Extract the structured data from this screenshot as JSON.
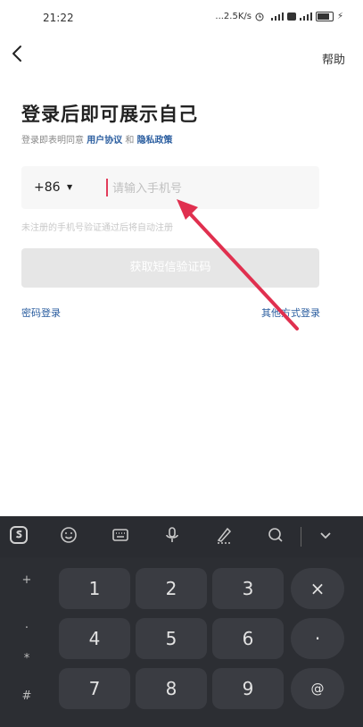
{
  "status_bar": {
    "time": "21:22",
    "net_speed": "...2.5K/s"
  },
  "header": {
    "help_label": "帮助"
  },
  "login": {
    "title": "登录后即可展示自己",
    "agreement_prefix": "登录即表明同意",
    "user_agreement": "用户协议",
    "and_text": "和",
    "privacy_policy": "隐私政策",
    "country_code": "+86",
    "country_dropdown_icon": "triangle-down-icon",
    "phone_placeholder": "请输入手机号",
    "register_note": "未注册的手机号验证通过后将自动注册",
    "sms_button": "获取短信验证码",
    "password_login": "密码登录",
    "other_login": "其他方式登录"
  },
  "keyboard": {
    "toolbar_icons": [
      "sogou-logo-icon",
      "emoji-icon",
      "keyboard-icon",
      "microphone-icon",
      "handwriting-icon",
      "search-icon",
      "collapse-chevron-icon"
    ],
    "symbols": [
      "+",
      ".",
      "*",
      "#"
    ],
    "rows": [
      [
        "1",
        "2",
        "3",
        "×"
      ],
      [
        "4",
        "5",
        "6",
        "·"
      ],
      [
        "7",
        "8",
        "9",
        "@"
      ]
    ]
  },
  "colors": {
    "link": "#2a5d9f",
    "caret": "#e23c5b",
    "arrow": "#e0304f",
    "keyboard_bg": "#2c2e33",
    "key_bg": "#3a3c42"
  }
}
